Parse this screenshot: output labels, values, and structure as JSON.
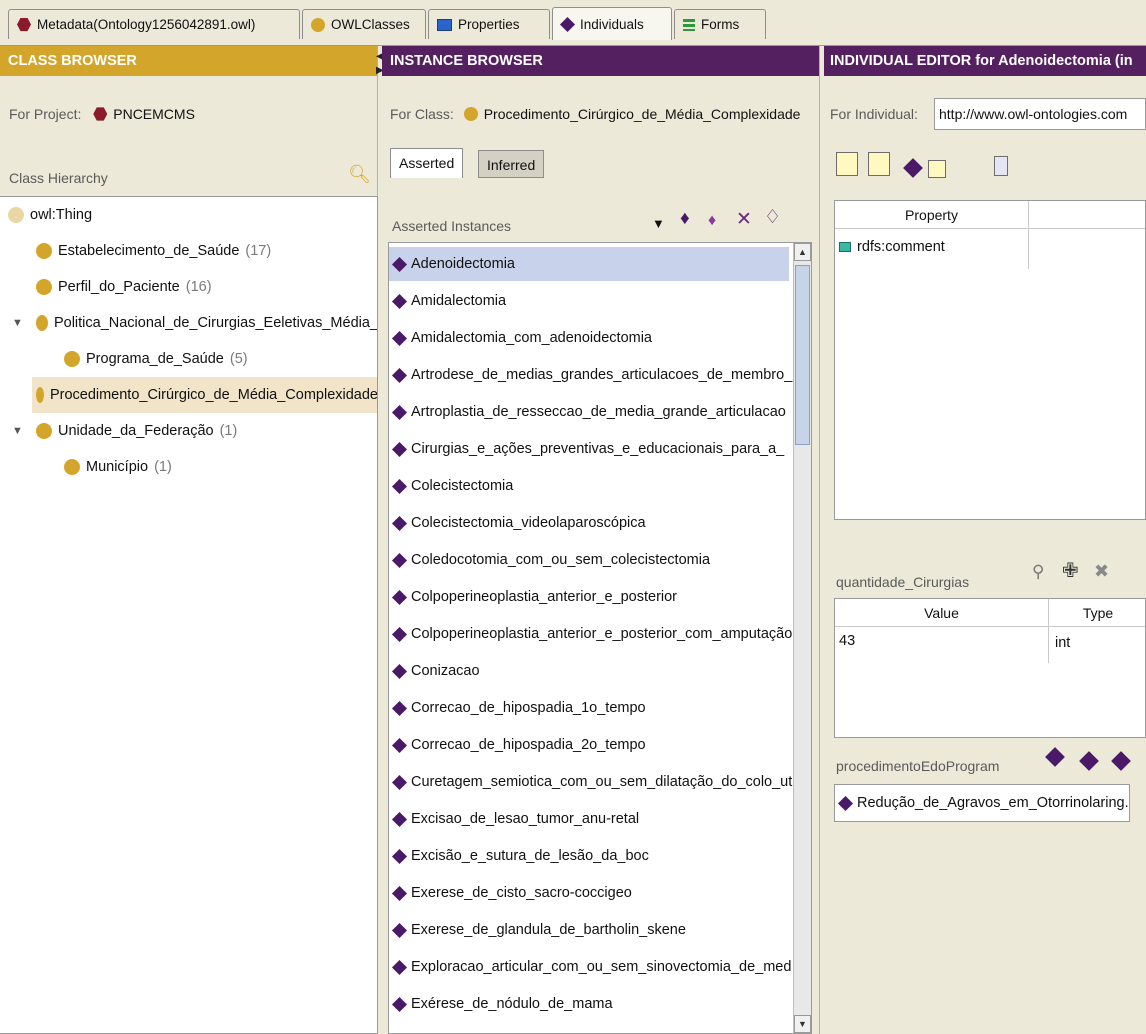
{
  "tabs": [
    {
      "label": "Metadata(Ontology1256042891.owl)",
      "icon": "ontology-hex-icon"
    },
    {
      "label": "OWLClasses",
      "icon": "class-circle-icon"
    },
    {
      "label": "Properties",
      "icon": "property-rect-icon"
    },
    {
      "label": "Individuals",
      "icon": "individual-diamond-icon"
    },
    {
      "label": "Forms",
      "icon": "forms-icon"
    }
  ],
  "class_browser": {
    "title": "CLASS BROWSER",
    "project_label": "For Project:",
    "project_name": "PNCEMCMS",
    "hierarchy_label": "Class Hierarchy",
    "classes": [
      {
        "name": "owl:Thing",
        "count": ""
      },
      {
        "name": "Estabelecimento_de_Saúde",
        "count": "(17)"
      },
      {
        "name": "Perfil_do_Paciente",
        "count": "(16)"
      },
      {
        "name": "Politica_Nacional_de_Cirurgias_Eeletivas_Média_",
        "count": ""
      },
      {
        "name": "Programa_de_Saúde",
        "count": "(5)"
      },
      {
        "name": "Procedimento_Cirúrgico_de_Média_Complexidade",
        "count": ""
      },
      {
        "name": "Unidade_da_Federação",
        "count": "(1)"
      },
      {
        "name": "Município",
        "count": "(1)"
      }
    ]
  },
  "instance_browser": {
    "title": "INSTANCE BROWSER",
    "class_label": "For Class:",
    "class_name": "Procedimento_Cirúrgico_de_Média_Complexidade",
    "tab_asserted": "Asserted",
    "tab_inferred": "Inferred",
    "list_label": "Asserted Instances",
    "instances": [
      "Adenoidectomia",
      "Amidalectomia",
      "Amidalectomia_com_adenoidectomia",
      "Artrodese_de_medias_grandes_articulacoes_de_membro_",
      "Artroplastia_de_resseccao_de_media_grande_articulacao",
      "Cirurgias_e_ações_preventivas_e_educacionais_para_a_",
      "Colecistectomia",
      "Colecistectomia_videolaparoscópica",
      "Coledocotomia_com_ou_sem_colecistectomia",
      "Colpoperineoplastia_anterior_e_posterior",
      "Colpoperineoplastia_anterior_e_posterior_com_amputação",
      "Conizacao",
      "Correcao_de_hipospadia_1o_tempo",
      "Correcao_de_hipospadia_2o_tempo",
      "Curetagem_semiotica_com_ou_sem_dilatação_do_colo_ut",
      "Excisao_de_lesao_tumor_anu-retal",
      "Excisão_e_sutura_de_lesão_da_boc",
      "Exerese_de_cisto_sacro-coccigeo",
      "Exerese_de_glandula_de_bartholin_skene",
      "Exploracao_articular_com_ou_sem_sinovectomia_de_med",
      "Exérese_de_nódulo_de_mama"
    ]
  },
  "individual_editor": {
    "title": "INDIVIDUAL EDITOR for Adenoidectomia  (in",
    "individual_label": "For Individual:",
    "individual_uri": "http://www.owl-ontologies.com",
    "property_header": "Property",
    "properties": [
      "rdfs:comment"
    ],
    "quantity_label": "quantidade_Cirurgias",
    "value_header": "Value",
    "type_header": "Type",
    "quantity_value": "43",
    "quantity_type": "int",
    "programa_label": "procedimentoEdoProgram",
    "programa_value": "Redução_de_Agravos_em_Otorrinolaring..."
  }
}
